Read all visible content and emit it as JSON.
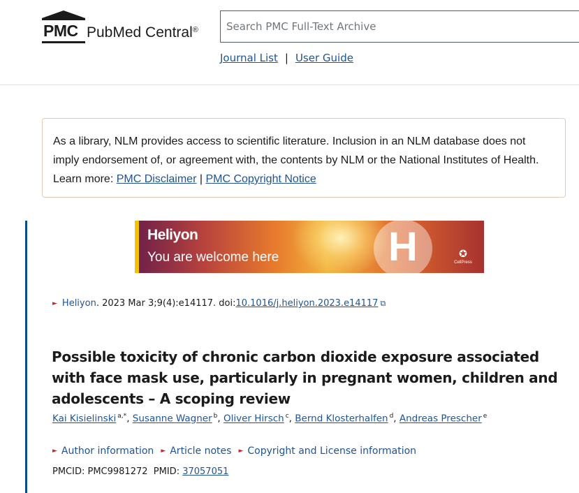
{
  "header": {
    "logo_mark": "PMC",
    "logo_text": "PubMed Central",
    "logo_reg": "®",
    "search_placeholder": "Search PMC Full-Text Archive",
    "links": [
      "Journal List",
      "|",
      "User Guide"
    ]
  },
  "disclaimer": {
    "text": "As a library, NLM provides access to scientific literature. Inclusion in an NLM database does not imply endorsement of, or agreement with, the contents by NLM or the National Institutes of Health. Learn more: ",
    "link1": "PMC Disclaimer",
    "separator": " | ",
    "link2": "PMC Copyright Notice"
  },
  "banner": {
    "title": "Heliyon",
    "subtitle": "You are welcome here",
    "logo_letter": "H",
    "publisher": "CellPress",
    "colors": {
      "edge": "#f2c200",
      "warm": "#e77a2d"
    }
  },
  "citation": {
    "journal": "Heliyon",
    "details": ". 2023 Mar 3;9(4):e14117. doi: ",
    "doi": "10.1016/j.heliyon.2023.e14117"
  },
  "article": {
    "title": "Possible toxicity of chronic carbon dioxide exposure associated with face mask use, particularly in pregnant women, children and adolescents – A scoping review"
  },
  "authors": [
    {
      "name": "Kai Kisielinski",
      "sup": "a,*"
    },
    {
      "name": "Susanne Wagner",
      "sup": "b"
    },
    {
      "name": "Oliver Hirsch",
      "sup": "c"
    },
    {
      "name": "Bernd Klosterhalfen",
      "sup": "d"
    },
    {
      "name": "Andreas Prescher",
      "sup": "e"
    }
  ],
  "info_links": [
    "Author information",
    "Article notes",
    "Copyright and License information"
  ],
  "ids": {
    "pmcid_label": "PMCID: PMC9981272",
    "pmid_label": "PMID:",
    "pmid": "37057051"
  },
  "colors": {
    "link": "#205493",
    "accent_bar": "#0b4b86",
    "triangle": "#c1272d"
  }
}
